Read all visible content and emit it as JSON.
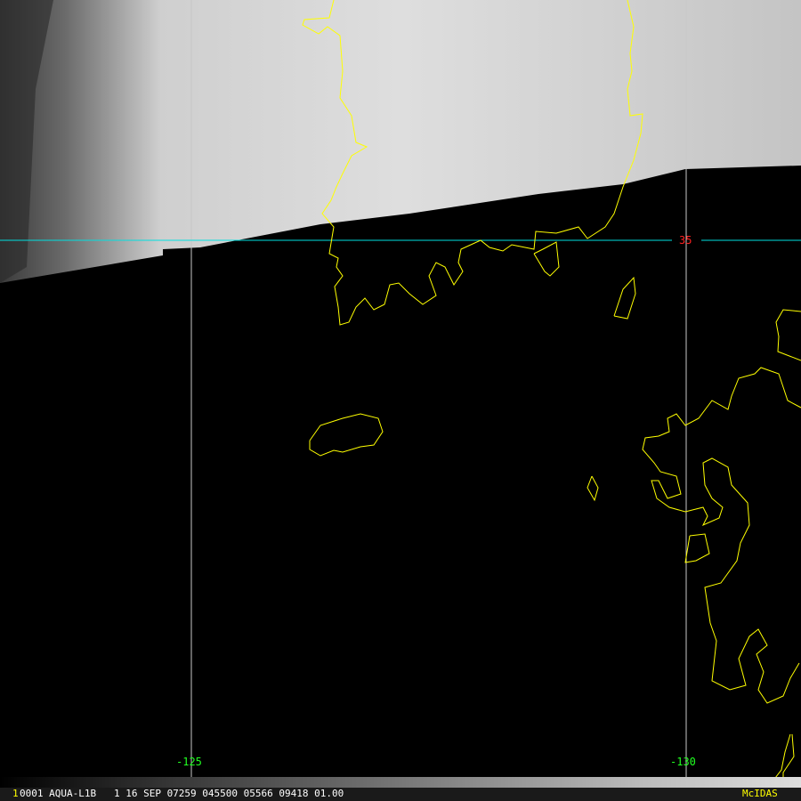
{
  "map": {
    "lat_label": "35",
    "lon_labels": [
      "-125",
      "-130"
    ],
    "colors": {
      "coast": "#ffff00",
      "lat_line": "#00e0e0",
      "lon_line": "#c8c8c8",
      "lat_text": "#ff2020",
      "lon_text": "#20ff20"
    }
  },
  "status_bar": {
    "frame_number": "1",
    "info": "0001 AQUA-L1B   1 16 SEP 07259 045500 05566 09418 01.00",
    "brand": "McIDAS"
  }
}
